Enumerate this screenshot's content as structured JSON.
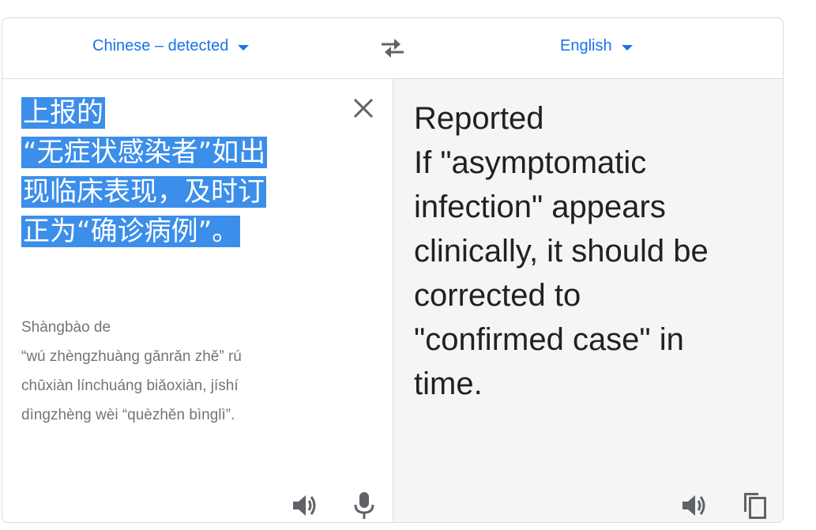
{
  "languages": {
    "source_label": "Chinese – detected",
    "target_label": "English"
  },
  "source": {
    "lines": [
      "上报的",
      "“无症状感染者”如出",
      "现临床表现，及时订",
      "正为“确诊病例”。"
    ],
    "romanization": [
      "Shàngbào de",
      "“wú zhèngzhuàng gǎnrǎn zhě” rú",
      "chūxiàn línchuáng biǎoxiàn, jíshí",
      "dìngzhèng wèi “quèzhěn bìnglì”."
    ]
  },
  "translation": {
    "lines": [
      "Reported",
      "If \"asymptomatic",
      "infection\" appears",
      "clinically, it should be",
      "corrected to",
      "\"confirmed case\" in",
      "time."
    ]
  },
  "icons": {
    "swap": "swap-arrows-icon",
    "clear": "close-icon",
    "listen_source": "speaker-icon",
    "mic": "microphone-icon",
    "listen_target": "speaker-icon",
    "copy": "copy-icon"
  },
  "colors": {
    "accent": "#1a73e8",
    "highlight": "#3b8eea",
    "icon": "#5f6368",
    "target_bg": "#f5f5f6"
  }
}
